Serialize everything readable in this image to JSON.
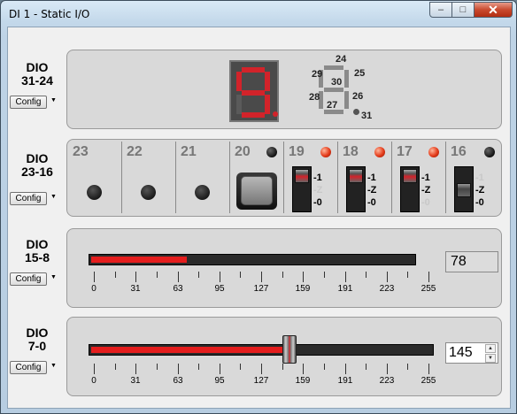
{
  "window": {
    "title": "DI 1 - Static I/O",
    "buttons": {
      "minimize": "–",
      "maximize": "□",
      "close": "✕"
    }
  },
  "config_label": "Config",
  "dio31_24": {
    "label_line1": "DIO",
    "label_line2": "31-24",
    "digit_display": "9.",
    "segment_numbers": [
      "24",
      "25",
      "26",
      "27",
      "28",
      "29",
      "30",
      "31"
    ]
  },
  "dio23_16": {
    "label_line1": "DIO",
    "label_line2": "23-16",
    "bits": [
      {
        "num": "23",
        "kind": "input-led"
      },
      {
        "num": "22",
        "kind": "input-led"
      },
      {
        "num": "21",
        "kind": "input-led"
      },
      {
        "num": "20",
        "kind": "pushbutton",
        "indicator": "black"
      },
      {
        "num": "19",
        "kind": "tristate",
        "indicator": "red",
        "state": "1"
      },
      {
        "num": "18",
        "kind": "tristate",
        "indicator": "red",
        "state": "1"
      },
      {
        "num": "17",
        "kind": "tristate",
        "indicator": "red",
        "state": "1"
      },
      {
        "num": "16",
        "kind": "tristate",
        "indicator": "black",
        "state": "Z"
      }
    ],
    "tristate_labels": [
      "-1",
      "-Z",
      "-0"
    ]
  },
  "dio15_8": {
    "label_line1": "DIO",
    "label_line2": "15-8",
    "value": "78",
    "level": 78,
    "max": 255,
    "tick_labels": [
      "0",
      "31",
      "63",
      "95",
      "127",
      "159",
      "191",
      "223",
      "255"
    ]
  },
  "dio7_0": {
    "label_line1": "DIO",
    "label_line2": "7-0",
    "value": "145",
    "level": 145,
    "max": 255,
    "tick_labels": [
      "0",
      "31",
      "63",
      "95",
      "127",
      "159",
      "191",
      "223",
      "255"
    ]
  },
  "colors": {
    "accent_red": "#e41d1d",
    "panel": "#d9d9d9"
  }
}
